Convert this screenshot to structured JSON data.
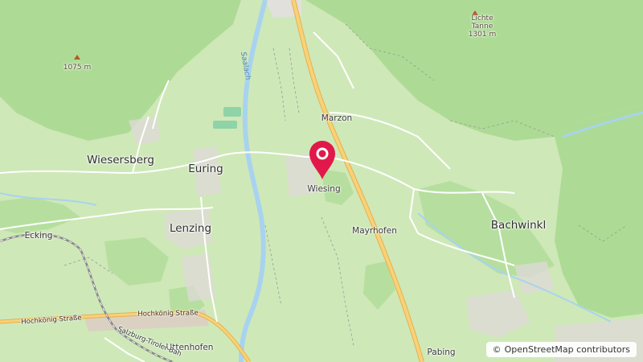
{
  "map": {
    "places": [
      {
        "name": "Wiesersberg",
        "size": "big"
      },
      {
        "name": "Euring",
        "size": "big"
      },
      {
        "name": "Lenzing",
        "size": "big"
      },
      {
        "name": "Bachwinkl",
        "size": "big"
      },
      {
        "name": "Marzon",
        "size": "small"
      },
      {
        "name": "Wiesing",
        "size": "small"
      },
      {
        "name": "Mayrhofen",
        "size": "small"
      },
      {
        "name": "Ecking",
        "size": "small"
      },
      {
        "name": "Uttenhofen",
        "size": "small"
      },
      {
        "name": "Pabing",
        "size": "small"
      }
    ],
    "peaks": {
      "lichte_tanne": {
        "line1": "Lichte",
        "line2": "Tanne",
        "elevation": "1301 m"
      },
      "unnamed": {
        "elevation": "1075 m"
      }
    },
    "river": "Saalach",
    "roads": {
      "hochkoenig_1": "Hochkönig Straße",
      "hochkoenig_2": "Hochkönig Straße",
      "salzburg_tiroler": "Salzburg-Tiroler-Bah"
    },
    "marker": {
      "icon": "map-pin-icon",
      "color": "#e0194a"
    }
  },
  "attribution": {
    "symbol": "©",
    "text": "OpenStreetMap contributors"
  },
  "colors": {
    "forest": "#addb95",
    "meadow": "#cfe8b8",
    "road_major": "#f2c86a",
    "water": "#a8d3ef",
    "settlement": "#e2e0dc"
  }
}
